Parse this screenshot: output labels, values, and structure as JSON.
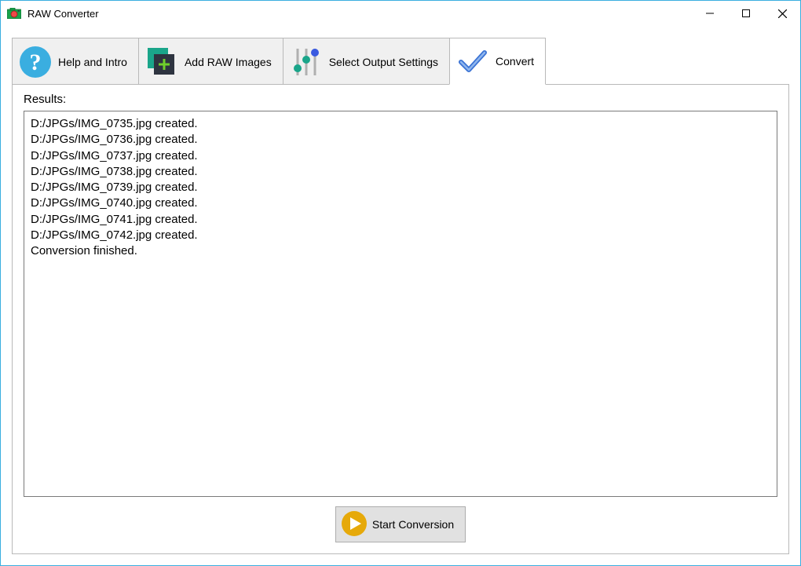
{
  "window": {
    "title": "RAW Converter"
  },
  "tabs": [
    {
      "label": "Help and Intro"
    },
    {
      "label": "Add RAW Images"
    },
    {
      "label": "Select Output Settings"
    },
    {
      "label": "Convert"
    }
  ],
  "results": {
    "label": "Results:",
    "lines": [
      "D:/JPGs/IMG_0735.jpg created.",
      "D:/JPGs/IMG_0736.jpg created.",
      "D:/JPGs/IMG_0737.jpg created.",
      "D:/JPGs/IMG_0738.jpg created.",
      "D:/JPGs/IMG_0739.jpg created.",
      "D:/JPGs/IMG_0740.jpg created.",
      "D:/JPGs/IMG_0741.jpg created.",
      "D:/JPGs/IMG_0742.jpg created.",
      "Conversion finished."
    ]
  },
  "start_button": {
    "label": "Start Conversion"
  }
}
